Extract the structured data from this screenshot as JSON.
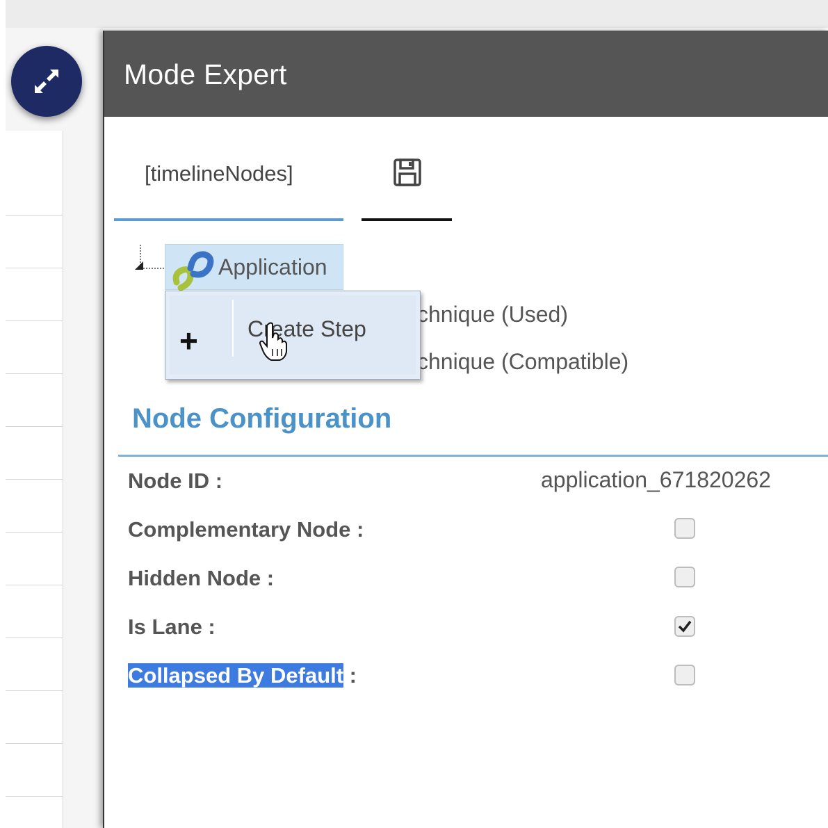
{
  "modal": {
    "title": "Mode Expert",
    "tabs": [
      {
        "label": "[timelineNodes]",
        "active": true
      },
      {
        "icon": "save-icon",
        "active": false
      }
    ]
  },
  "fab": {
    "icon": "expand-icon"
  },
  "tree": {
    "root": {
      "label": "Application",
      "icon": "link-chain-icon"
    },
    "partially_hidden_items": [
      "chnique (Used)",
      "chnique (Compatible)"
    ]
  },
  "context_menu": {
    "items": [
      {
        "icon": "plus-icon",
        "label": "Create Step"
      }
    ]
  },
  "node_configuration": {
    "title": "Node Configuration",
    "fields": {
      "node_id": {
        "label": "Node ID :",
        "value": "application_671820262"
      },
      "complementary": {
        "label": "Complementary Node :",
        "checked": false
      },
      "hidden": {
        "label": "Hidden Node :",
        "checked": false
      },
      "is_lane": {
        "label": "Is Lane :",
        "checked": true
      },
      "collapsed": {
        "label": "Collapsed By Default",
        "suffix": " :",
        "checked": false
      }
    }
  },
  "colors": {
    "header": "#555555",
    "accent_blue": "#4a92c8",
    "fab": "#1d2a63",
    "selection": "#3d7be0"
  }
}
